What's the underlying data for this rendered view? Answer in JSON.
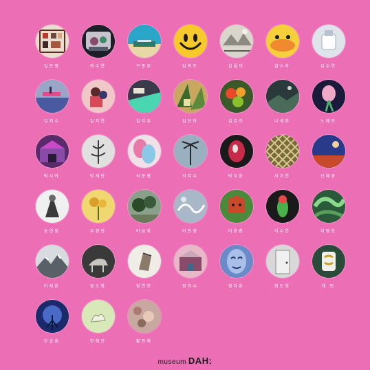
{
  "artists": [
    {
      "name": "김은영"
    },
    {
      "name": "곽수연"
    },
    {
      "name": "구준효"
    },
    {
      "name": "김버토"
    },
    {
      "name": "김을미"
    },
    {
      "name": "김소라"
    },
    {
      "name": "김수연"
    },
    {
      "name": "김지수"
    },
    {
      "name": "김지연"
    },
    {
      "name": "김지유"
    },
    {
      "name": "김진아"
    },
    {
      "name": "김효진"
    },
    {
      "name": "나세현"
    },
    {
      "name": "노혜인"
    },
    {
      "name": "박시아"
    },
    {
      "name": "박세인"
    },
    {
      "name": "석문형"
    },
    {
      "name": "석지수"
    },
    {
      "name": "박지윤"
    },
    {
      "name": "서가연"
    },
    {
      "name": "신혜영"
    },
    {
      "name": "송연정"
    },
    {
      "name": "우정인"
    },
    {
      "name": "이금희"
    },
    {
      "name": "이인정"
    },
    {
      "name": "이윤환"
    },
    {
      "name": "이수연"
    },
    {
      "name": "이영한"
    },
    {
      "name": "이지윤"
    },
    {
      "name": "장소희"
    },
    {
      "name": "정연진"
    },
    {
      "name": "정이수"
    },
    {
      "name": "정지윤"
    },
    {
      "name": "최도희"
    },
    {
      "name": "채 인"
    },
    {
      "name": "한상훈"
    },
    {
      "name": "한혜진"
    },
    {
      "name": "황민애"
    }
  ],
  "footer": {
    "brand_prefix": "museum",
    "brand_mark": "DAH:"
  },
  "colors": {
    "background": "#ec6fb6",
    "text": "#ffffff"
  }
}
